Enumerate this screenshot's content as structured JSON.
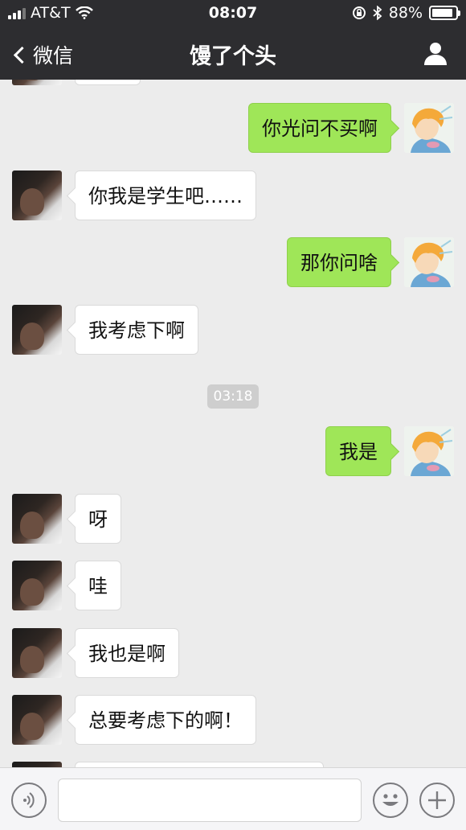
{
  "status_bar": {
    "carrier": "AT&T",
    "time": "08:07",
    "battery_text": "88%",
    "battery_level": 0.88
  },
  "nav": {
    "back_label": "微信",
    "title": "馒了个头",
    "user_icon": "user-icon"
  },
  "messages": [
    {
      "side": "right",
      "text": "你光问不买啊"
    },
    {
      "side": "left",
      "text": "你我是学生吧……"
    },
    {
      "side": "right",
      "text": "那你问啥"
    },
    {
      "side": "left",
      "text": "我考虑下啊"
    },
    {
      "side": "right",
      "text": "我是"
    },
    {
      "side": "left",
      "text": "呀"
    },
    {
      "side": "left",
      "text": "哇"
    },
    {
      "side": "left",
      "text": "我也是啊"
    },
    {
      "side": "left",
      "text": "总要考虑下的啊！"
    }
  ],
  "timestamp": "03:18",
  "input_bar": {
    "icons": [
      "voice-icon",
      "emoji-icon",
      "plus-icon"
    ],
    "placeholder": ""
  }
}
